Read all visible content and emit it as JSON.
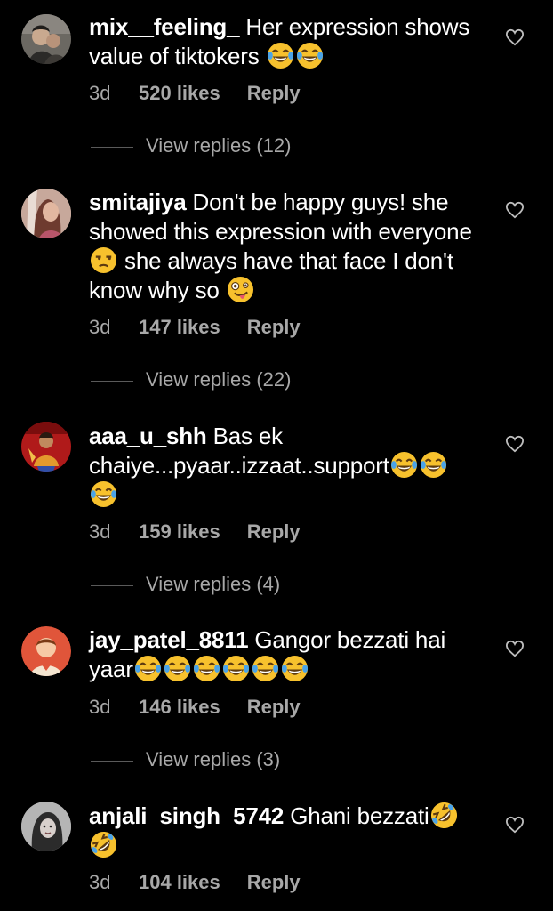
{
  "colors": {
    "background": "#000000",
    "text": "#ffffff",
    "secondary": "#a8a8a8",
    "emoji_yellow": "#f7c12d"
  },
  "comments": [
    {
      "username": "mix__feeling_",
      "text": " Her expression shows value of tiktokers ",
      "emojis": [
        "laughing-tears-emoji",
        "laughing-tears-emoji"
      ],
      "time": "3d",
      "likes": "520 likes",
      "reply": "Reply",
      "view_replies": "View replies (12)",
      "avatar": "photo-avatar"
    },
    {
      "username": "smitajiya",
      "text_1": " Don't be happy guys! she showed this expression with everyone ",
      "text_2": " she always have that face I don't know why so ",
      "emojis": [
        "unamused-emoji",
        "zany-face-emoji"
      ],
      "time": "3d",
      "likes": "147 likes",
      "reply": "Reply",
      "view_replies": "View replies (22)",
      "avatar": "photo-avatar"
    },
    {
      "username": "aaa_u_shh",
      "text": " Bas ek chaiye...pyaar..izzaat..support",
      "emojis": [
        "laughing-tears-emoji",
        "laughing-tears-emoji",
        "laughing-tears-emoji"
      ],
      "time": "3d",
      "likes": "159 likes",
      "reply": "Reply",
      "view_replies": "View replies (4)",
      "avatar": "photo-avatar"
    },
    {
      "username": "jay_patel_8811",
      "text": " Gangor bezzati hai yaar",
      "emojis": [
        "laughing-tears-emoji",
        "laughing-tears-emoji",
        "laughing-tears-emoji",
        "laughing-tears-emoji",
        "laughing-tears-emoji",
        "laughing-tears-emoji"
      ],
      "time": "3d",
      "likes": "146 likes",
      "reply": "Reply",
      "view_replies": "View replies (3)",
      "avatar": "cartoon-avatar"
    },
    {
      "username": "anjali_singh_5742",
      "text": " Ghani bezzati",
      "emojis": [
        "rolling-laughing-emoji",
        "rolling-laughing-emoji"
      ],
      "time": "3d",
      "likes": "104 likes",
      "reply": "Reply",
      "avatar": "photo-avatar"
    }
  ]
}
